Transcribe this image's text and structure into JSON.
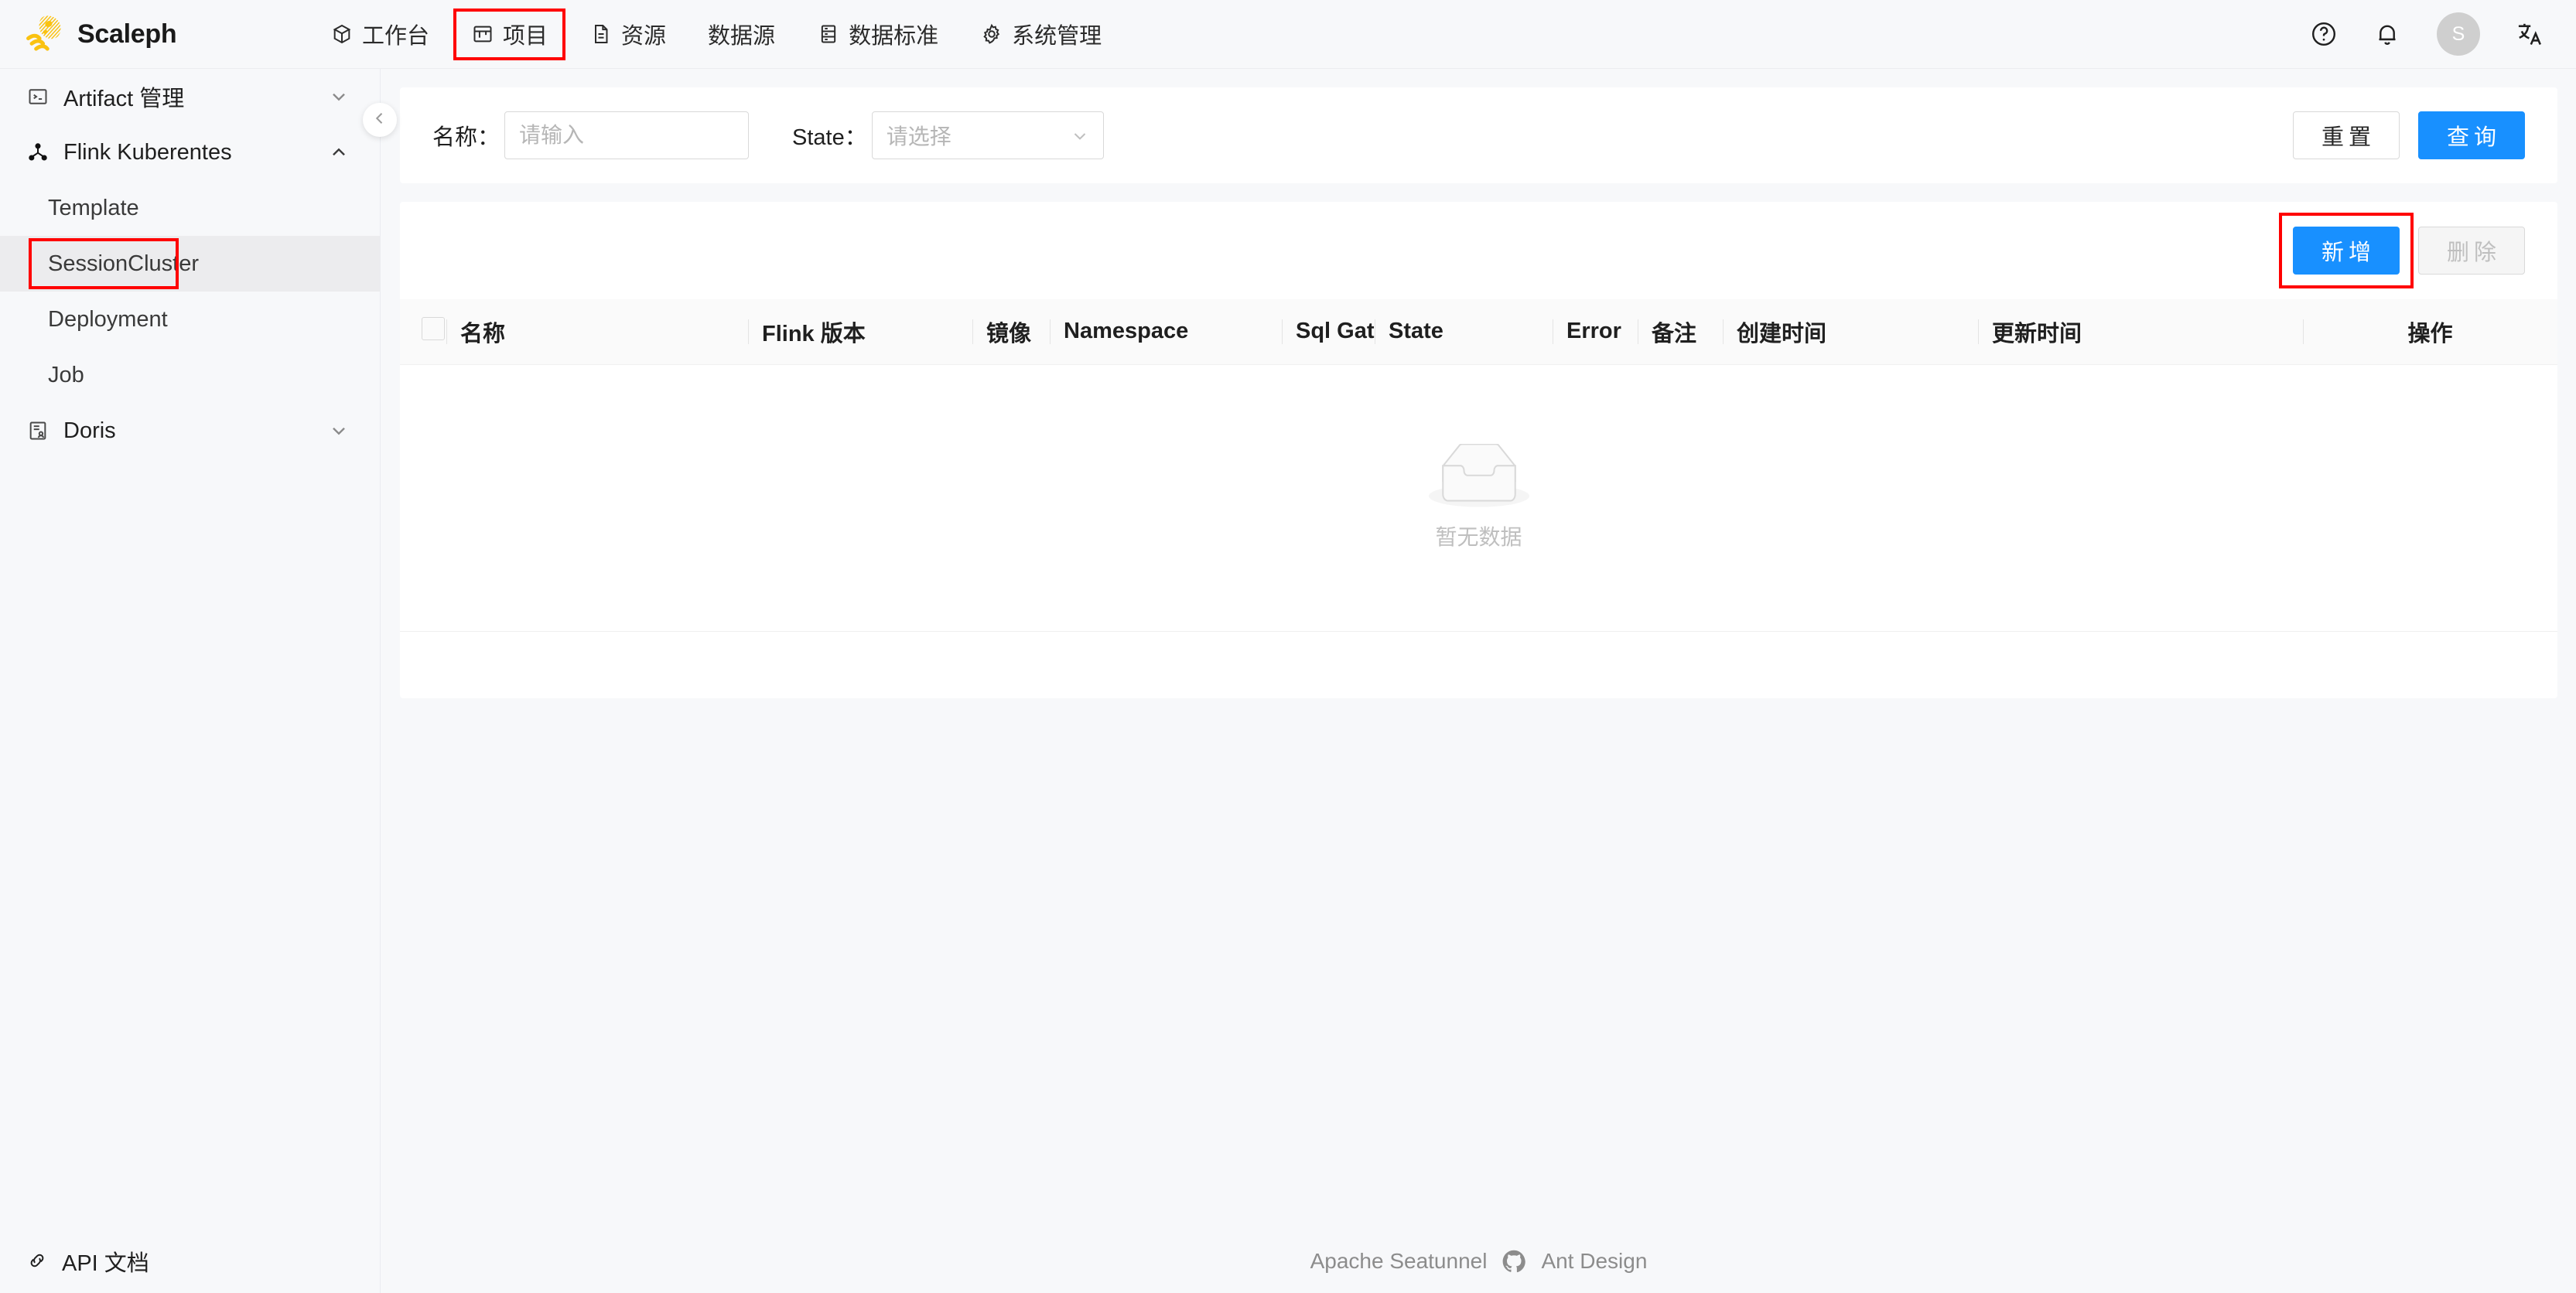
{
  "app": {
    "brand_name": "Scaleph",
    "logo_icon": "jellyfish-logo-icon",
    "accent_color": "#1890ff",
    "highlight_color": "#ff0000",
    "logo_color": "#fac211"
  },
  "header": {
    "nav": [
      {
        "label": "工作台",
        "icon": "workbench-cube-icon",
        "highlighted": false
      },
      {
        "label": "项目",
        "icon": "project-icon",
        "highlighted": true
      },
      {
        "label": "资源",
        "icon": "resource-file-icon",
        "highlighted": false
      },
      {
        "label": "数据源",
        "icon": "",
        "highlighted": false
      },
      {
        "label": "数据标准",
        "icon": "data-standard-icon",
        "highlighted": false
      },
      {
        "label": "系统管理",
        "icon": "gear-icon",
        "highlighted": false
      }
    ],
    "actions": {
      "help_icon": "question-circle-icon",
      "bell_icon": "bell-icon",
      "avatar_letter": "S",
      "language_icon": "translate-icon"
    }
  },
  "sidebar": {
    "collapse_icon": "chevron-left-icon",
    "groups": [
      {
        "label": "Artifact 管理",
        "icon": "terminal-icon",
        "expanded": false,
        "chevron": "chevron-down-icon",
        "items": []
      },
      {
        "label": "Flink Kuberentes",
        "icon": "cluster-node-icon",
        "expanded": true,
        "chevron": "chevron-up-icon",
        "items": [
          {
            "label": "Template",
            "active": false,
            "highlighted": false
          },
          {
            "label": "SessionCluster",
            "active": true,
            "highlighted": true
          },
          {
            "label": "Deployment",
            "active": false,
            "highlighted": false
          },
          {
            "label": "Job",
            "active": false,
            "highlighted": false
          }
        ]
      },
      {
        "label": "Doris",
        "icon": "doris-doc-icon",
        "expanded": false,
        "chevron": "chevron-down-icon",
        "items": []
      }
    ],
    "api_docs": {
      "label": "API 文档",
      "icon": "link-icon"
    }
  },
  "filter": {
    "name_label": "名称：",
    "name_value": "",
    "name_placeholder": "请输入",
    "state_label": "State：",
    "state_value": "",
    "state_placeholder": "请选择",
    "state_chevron": "chevron-down-icon",
    "reset_label": "重置",
    "query_label": "查询"
  },
  "table": {
    "toolbar": {
      "add_label": "新增",
      "add_highlighted": true,
      "delete_label": "删除",
      "delete_disabled": true
    },
    "columns": [
      {
        "key": "checkbox",
        "label": ""
      },
      {
        "key": "name",
        "label": "名称"
      },
      {
        "key": "flink_version",
        "label": "Flink 版本"
      },
      {
        "key": "image",
        "label": "镜像"
      },
      {
        "key": "namespace",
        "label": "Namespace"
      },
      {
        "key": "sql_gateway",
        "label": "Sql Gateway"
      },
      {
        "key": "state",
        "label": "State"
      },
      {
        "key": "error",
        "label": "Error"
      },
      {
        "key": "remark",
        "label": "备注"
      },
      {
        "key": "create_time",
        "label": "创建时间"
      },
      {
        "key": "update_time",
        "label": "更新时间"
      },
      {
        "key": "action",
        "label": "操作"
      }
    ],
    "rows": [],
    "empty_text": "暂无数据",
    "empty_icon": "empty-box-icon"
  },
  "footer": {
    "left_label": "Apache Seatunnel",
    "github_icon": "github-icon",
    "right_label": "Ant Design"
  }
}
